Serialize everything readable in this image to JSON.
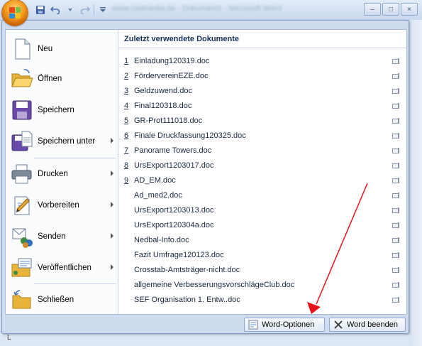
{
  "window": {
    "title_url": "www.cadmedia.de - Dokument1 - Microsoft Word",
    "controls": [
      "–",
      "□",
      "×"
    ]
  },
  "ruler_mark": "L",
  "menu": {
    "commands": [
      {
        "label": "Neu",
        "icon": "new-document-icon",
        "submenu": false
      },
      {
        "label": "Öffnen",
        "icon": "open-folder-icon",
        "submenu": false
      },
      {
        "label": "Speichern",
        "icon": "save-disk-icon",
        "submenu": false
      },
      {
        "label": "Speichern unter",
        "icon": "save-as-icon",
        "submenu": true
      },
      {
        "label": "Drucken",
        "icon": "printer-icon",
        "submenu": true
      },
      {
        "label": "Vorbereiten",
        "icon": "prepare-icon",
        "submenu": true
      },
      {
        "label": "Senden",
        "icon": "send-icon",
        "submenu": true
      },
      {
        "label": "Veröffentlichen",
        "icon": "publish-icon",
        "submenu": true
      },
      {
        "label": "Schließen",
        "icon": "close-folder-icon",
        "submenu": false
      }
    ],
    "recent_title": "Zuletzt verwendete Dokumente",
    "recent": [
      {
        "num": "1",
        "name": "Einladung120319.doc"
      },
      {
        "num": "2",
        "name": "FördervereinEZE.doc"
      },
      {
        "num": "3",
        "name": "Geldzuwend.doc"
      },
      {
        "num": "4",
        "name": "Final120318.doc"
      },
      {
        "num": "5",
        "name": "GR-Prot111018.doc"
      },
      {
        "num": "6",
        "name": "Finale Druckfassung120325.doc"
      },
      {
        "num": "7",
        "name": "Panorame Towers.doc"
      },
      {
        "num": "8",
        "name": "UrsExport1203017.doc"
      },
      {
        "num": "9",
        "name": "AD_EM.doc"
      },
      {
        "num": "",
        "name": "Ad_med2.doc"
      },
      {
        "num": "",
        "name": "UrsExport1203013.doc"
      },
      {
        "num": "",
        "name": "UrsExport120304a.doc"
      },
      {
        "num": "",
        "name": "Nedbal-Info.doc"
      },
      {
        "num": "",
        "name": "Fazit Umfrage120123.doc"
      },
      {
        "num": "",
        "name": "Crosstab-Amtsträger-nicht.doc"
      },
      {
        "num": "",
        "name": "allgemeine VerbesserungsvorschlägeClub.doc"
      },
      {
        "num": "",
        "name": "SEF Organisation 1. Entw..doc"
      }
    ],
    "word_options_label": "Word-Optionen",
    "exit_word_label": "Word beenden"
  },
  "colors": {
    "annotation_arrow": "#e8101a",
    "office_orange": "#f59a1a"
  }
}
